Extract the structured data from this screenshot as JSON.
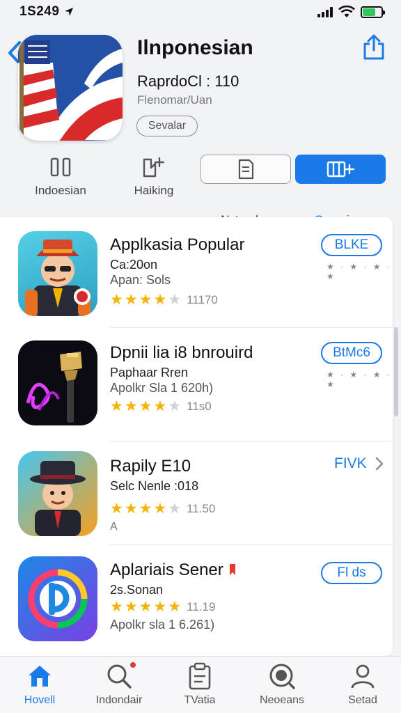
{
  "status_bar": {
    "time": "1S249"
  },
  "header": {
    "title": "Ilnponesian",
    "subtitle": "RaprdoCl : 110",
    "developer": "Flenomar/Uan",
    "seller_label": "Sevalar"
  },
  "actions": [
    {
      "label": "Indoesian",
      "icon": "pause-bars-icon"
    },
    {
      "label": "Haiking",
      "icon": "edit-plus-icon"
    },
    {
      "label": "Nstandny",
      "icon": "document-icon"
    },
    {
      "label": "Crapniera",
      "icon": "add-grid-icon"
    }
  ],
  "apps": [
    {
      "name": "Applkasia Popular",
      "line1": "Ca:20on",
      "line2": "Apan: Sols",
      "rating": 4,
      "rating_count": "11170",
      "button": "BLKE",
      "button_style": "pill",
      "mini_stars": "★ · ★ · ★ · ★"
    },
    {
      "name": "Dpnii lia i8 bnrouird",
      "line1": "Paphaar Rren",
      "line2": "Apolkr Sla 1 620h)",
      "rating": 4,
      "rating_count": "11s0",
      "button": "BtMc6",
      "button_style": "pill",
      "mini_stars": "★ · ★ · ★ · ★"
    },
    {
      "name": "Rapily E10",
      "line1": "Selc Nenle :018",
      "line2": "A",
      "rating": 4,
      "rating_count": "11.50",
      "button": "FIVK",
      "button_style": "link"
    },
    {
      "name": "Aplariais Sener",
      "line1": "2s.Sonan",
      "line2": "Apolkr sla 1 6.261)",
      "rating": 4.5,
      "rating_count": "11.19",
      "button": "Fl ds",
      "button_style": "pill"
    }
  ],
  "tabs": [
    {
      "label": "Hovell",
      "icon": "home-icon",
      "active": true
    },
    {
      "label": "Indondair",
      "icon": "search-icon",
      "active": false
    },
    {
      "label": "TVatia",
      "icon": "clipboard-icon",
      "active": false
    },
    {
      "label": "Neoeans",
      "icon": "discover-icon",
      "active": false
    },
    {
      "label": "Setad",
      "icon": "person-icon",
      "active": false
    }
  ],
  "colors": {
    "accent": "#1a7ae8",
    "star": "#f5b301",
    "background": "#f2f3f6"
  }
}
